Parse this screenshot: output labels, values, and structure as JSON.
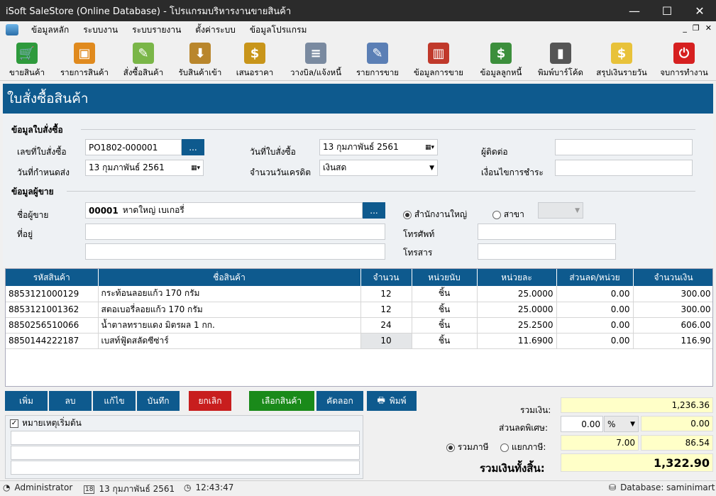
{
  "window": {
    "title": "iSoft SaleStore (Online Database) - โปรแกรมบริหารงานขายสินค้า",
    "min": "—",
    "max": "☐",
    "close": "✕"
  },
  "menu": [
    "ข้อมูลหลัก",
    "ระบบงาน",
    "ระบบรายงาน",
    "ตั้งค่าระบบ",
    "ข้อมูลโปรแกรม"
  ],
  "mdi": {
    "min": "_",
    "restore": "❐",
    "close": "✕"
  },
  "toolbar": [
    {
      "label": "ขายสินค้า",
      "icon": "cart-icon",
      "color": "#2e9a3c",
      "glyph": "🛒"
    },
    {
      "label": "รายการสินค้า",
      "icon": "box-icon",
      "color": "#e08a1e",
      "glyph": "▣"
    },
    {
      "label": "สั่งซื้อสินค้า",
      "icon": "pen-icon",
      "color": "#7ab648",
      "glyph": "✎"
    },
    {
      "label": "รับสินค้าเข้า",
      "icon": "receive-box-icon",
      "color": "#b9862c",
      "glyph": "⬇"
    },
    {
      "label": "เสนอราคา",
      "icon": "quote-hand-icon",
      "color": "#c8951a",
      "glyph": "$"
    },
    {
      "label": "วางบิล/แจ้งหนี้",
      "icon": "invoice-icon",
      "color": "#7a8aa0",
      "glyph": "≡"
    },
    {
      "label": "รายการขาย",
      "icon": "sales-list-icon",
      "color": "#5b7fb5",
      "glyph": "✎"
    },
    {
      "label": "ข้อมูลการขาย",
      "icon": "binders-icon",
      "color": "#c0392b",
      "glyph": "▥"
    },
    {
      "label": "ข้อมูลลูกหนี้",
      "icon": "debtor-icon",
      "color": "#3c8f3c",
      "glyph": "$"
    },
    {
      "label": "พิมพ์บาร์โค้ด",
      "icon": "barcode-icon",
      "color": "#555555",
      "glyph": "▮"
    },
    {
      "label": "สรุปเงินรายวัน",
      "icon": "lightbulb-icon",
      "color": "#e8c23a",
      "glyph": "$"
    },
    {
      "label": "จบการทำงาน",
      "icon": "power-icon",
      "color": "#d62020",
      "glyph": "⏻"
    }
  ],
  "page_title": "ใบสั่งซื้อสินค้า",
  "order": {
    "section": "ข้อมูลใบสั่งซื้อ",
    "po_no_label": "เลขที่ใบสั่งซื้อ",
    "po_no": "PO1802-000001",
    "po_date_label": "วันที่ใบสั่งซื้อ",
    "po_date": "13  กุมภาพันธ์   2561",
    "contact_label": "ผู้ติดต่อ",
    "contact": "",
    "due_date_label": "วันที่กำหนดส่ง",
    "due_date": "13  กุมภาพันธ์   2561",
    "credit_label": "จำนวนวันเครดิต",
    "credit": "เงินสด",
    "terms_label": "เงื่อนไขการชำระ",
    "terms": "",
    "browse": "..."
  },
  "vendor": {
    "section": "ข้อมูลผู้ขาย",
    "name_label": "ชื่อผู้ขาย",
    "code": "00001",
    "name": "หาดใหญ่ เบเกอรี่",
    "hq_label": "สำนักงานใหญ่",
    "branch_label": "สาขา",
    "branch": "",
    "address_label": "ที่อยู่",
    "address1": "",
    "address2": "",
    "phone_label": "โทรศัพท์",
    "phone": "",
    "fax_label": "โทรสาร",
    "fax": ""
  },
  "table": {
    "headers": [
      "รหัสสินค้า",
      "ชื่อสินค้า",
      "จำนวน",
      "หน่วยนับ",
      "หน่วยละ",
      "ส่วนลด/หน่วย",
      "จำนวนเงิน"
    ],
    "rows": [
      [
        "8853121000129",
        "กระท้อนลอยแก้ว 170 กรัม",
        "12",
        "ชิ้น",
        "25.0000",
        "0.00",
        "300.00"
      ],
      [
        "8853121001362",
        "สตอเบอรี่ลอยแก้ว 170 กรัม",
        "12",
        "ชิ้น",
        "25.0000",
        "0.00",
        "300.00"
      ],
      [
        "8850256510066",
        "น้ำตาลทรายแดง มิตรผล 1 กก.",
        "24",
        "ชิ้น",
        "25.2500",
        "0.00",
        "606.00"
      ],
      [
        "8850144222187",
        "เบสท์ฟู้ดสลัดซีซ่าร์",
        "10",
        "ชิ้น",
        "11.6900",
        "0.00",
        "116.90"
      ]
    ]
  },
  "buttons": {
    "add": "เพิ่ม",
    "delete": "ลบ",
    "edit": "แก้ไข",
    "save": "บันทึก",
    "cancel": "ยกเลิก",
    "select": "เลือกสินค้า",
    "copy": "คัดลอก",
    "print": "พิมพ์",
    "print_icon": "printer-icon"
  },
  "notes": {
    "label": "หมายเหตุเริ่มต้น",
    "checked": true
  },
  "totals": {
    "sum_label": "รวมเงิน:",
    "sum": "1,236.36",
    "discount_label": "ส่วนลดพิเศษ:",
    "discount_value": "0.00",
    "discount_unit": "%",
    "discount_amount": "0.00",
    "vat_incl_label": "รวมภาษี",
    "vat_excl_label": "แยกภาษี:",
    "vat_rate": "7.00",
    "vat_amount": "86.54",
    "grand_label": "รวมเงินทั้งสิ้น:",
    "grand": "1,322.90"
  },
  "status": {
    "user": "Administrator",
    "date": "13 กุมภาพันธ์ 2561",
    "time": "12:43:47",
    "db": "Database: saminimart",
    "cal_day": "18"
  },
  "colors": {
    "primary": "#0e5a8e",
    "cancel": "#c81e1e",
    "select": "#1a8a1a",
    "total_bg": "#ffffc8"
  }
}
